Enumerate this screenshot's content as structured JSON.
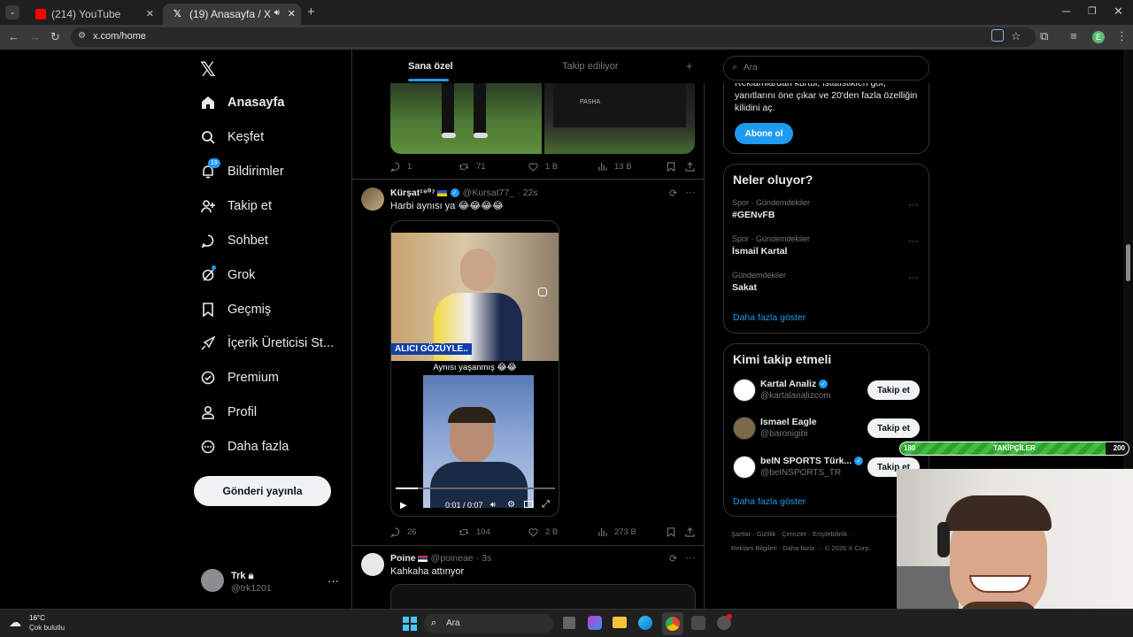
{
  "browser": {
    "tabs": [
      {
        "title": "(214) YouTube",
        "active": false
      },
      {
        "title": "(19) Anasayfa / X",
        "active": true
      }
    ],
    "url": "x.com/home",
    "profile_initial": "E"
  },
  "nav": {
    "items": [
      {
        "label": "Anasayfa",
        "icon": "home-icon"
      },
      {
        "label": "Keşfet",
        "icon": "search-icon"
      },
      {
        "label": "Bildirimler",
        "icon": "bell-icon",
        "badge": "19"
      },
      {
        "label": "Takip et",
        "icon": "follow-icon"
      },
      {
        "label": "Sohbet",
        "icon": "chat-icon"
      },
      {
        "label": "Grok",
        "icon": "grok-icon"
      },
      {
        "label": "Geçmiş",
        "icon": "bookmark-icon"
      },
      {
        "label": "İçerik Üreticisi St...",
        "icon": "rocket-icon"
      },
      {
        "label": "Premium",
        "icon": "premium-icon"
      },
      {
        "label": "Profil",
        "icon": "profile-icon"
      },
      {
        "label": "Daha fazla",
        "icon": "more-circle-icon"
      }
    ],
    "post_button": "Gönderi yayınla",
    "account": {
      "name": "Trk",
      "handle": "@trk1201"
    }
  },
  "feed": {
    "tabs": [
      "Sana özel",
      "Takip ediliyor"
    ],
    "post1_stats": {
      "replies": "1",
      "reposts": "71",
      "likes": "1 B",
      "views": "13 B"
    },
    "post2": {
      "name": "Kürşat¹⁹⁰⁷",
      "handle": "@Kursat77_",
      "time": "22s",
      "text": "Harbi aynısı ya 😂😂😂😂",
      "media_caption_top": "ALICI GÖZÜYLE..",
      "media_caption_mid": "Aynısı yaşanmış 😂😂",
      "video_time": "0:01 / 0:07",
      "video_progress": 0.14,
      "stats": {
        "replies": "26",
        "reposts": "104",
        "likes": "2 B",
        "views": "273 B"
      }
    },
    "post3": {
      "name": "Poine",
      "handle": "@poineae",
      "time": "3s",
      "text": "Kahkaha attınyor"
    }
  },
  "right": {
    "search_placeholder": "Ara",
    "premium_text": "Reklamlardan kurtul, istatistikleri gör, yanıtlarını öne çıkar ve 20'den fazla özelliğin kilidini aç.",
    "subscribe": "Abone ol",
    "trends_title": "Neler oluyor?",
    "trends": [
      {
        "meta": "Spor · Gündemdekiler",
        "name": "#GENvFB"
      },
      {
        "meta": "Spor · Gündemdekiler",
        "name": "İsmail Kartal"
      },
      {
        "meta": "Gündemdekiler",
        "name": "Sakat"
      }
    ],
    "show_more": "Daha fazla göster",
    "who_title": "Kimi takip etmeli",
    "who": [
      {
        "name": "Kartal Analiz",
        "handle": "@kartalanalizcom",
        "button": "Takip et"
      },
      {
        "name": "Ismael Eagle",
        "handle": "@baronigibi",
        "button": "Takip et"
      },
      {
        "name": "beIN SPORTS Türk...",
        "handle": "@beINSPORTS_TR",
        "button": "Takip et"
      }
    ],
    "who_more": "Daha fazla göster",
    "footer_line1": "Şartlar · Gizlilik · Çerezler · Erişilebilirlik ·",
    "footer_line2": "Reklam Bilgileri · Daha fazla ··· © 2026 X Corp."
  },
  "followers_bar": {
    "left": "180",
    "label": "TAKİPÇİLER",
    "right": "200",
    "progress": 0.9
  },
  "taskbar": {
    "weather_temp": "16°C",
    "weather_text": "Çok bulutlu",
    "search": "Ara"
  },
  "colors": {
    "accent": "#1d9bf0",
    "verified": "#1d9bf0",
    "bar_green": "#3fbf3f"
  }
}
